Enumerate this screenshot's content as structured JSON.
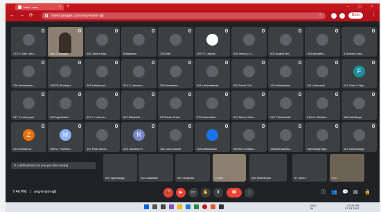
{
  "browser": {
    "tab_title": "Meet - nww",
    "tab_close": "×",
    "new_tab": "+",
    "window_controls": "– ▢ ×",
    "url": "meet.google.com/ovg-fmym-qfj",
    "error_label": "Error",
    "back": "←",
    "forward": "→",
    "reload": "⟳",
    "star": "☆",
    "menu": "⋮"
  },
  "tiles": [
    {
      "name": "273 S Julie Lalru...",
      "avatar": "",
      "color": "#5f6368"
    },
    {
      "name": "Hau Chhangte",
      "avatar": "",
      "color": "#5f6368",
      "video": true
    },
    {
      "name": "081 James Ngu...",
      "avatar": "",
      "color": "#5f6368"
    },
    {
      "name": "Malsawma",
      "avatar": "",
      "color": "#5f6368"
    },
    {
      "name": "103 Mali",
      "avatar": "",
      "color": "#5f6368"
    },
    {
      "name": "326 77.Lalduat...",
      "avatar": "",
      "color": "#ffffff"
    },
    {
      "name": "048 Henry L.H...",
      "avatar": "",
      "color": "#5f6368"
    },
    {
      "name": "002 Angela Bei...",
      "avatar": "",
      "color": "#5f6368"
    },
    {
      "name": "164Lalruatfha...",
      "avatar": "",
      "color": "#5f6368"
    },
    {
      "name": "4.Debory Lalru...",
      "avatar": "",
      "color": "#5f6368"
    },
    {
      "name": "220 Vanlalrinaw...",
      "avatar": "",
      "color": "#5f6368"
    },
    {
      "name": "163 PC Rohtupui",
      "avatar": "",
      "color": "#5f6368"
    },
    {
      "name": "049 Lalfakzuali...",
      "avatar": "",
      "color": "#5f6368"
    },
    {
      "name": "014 C.Lalremru...",
      "avatar": "",
      "color": "#5f6368"
    },
    {
      "name": "295 Vanlalrem...",
      "avatar": "",
      "color": "#5f6368"
    },
    {
      "name": "091 Lalrindmawia",
      "avatar": "",
      "color": "#5f6368"
    },
    {
      "name": "030 David Chh...",
      "avatar": "",
      "color": "#5f6368"
    },
    {
      "name": "12.Lalchhanhimi",
      "avatar": "",
      "color": "#5f6368"
    },
    {
      "name": "114.Lalremeuli",
      "avatar": "",
      "color": "#5f6368"
    },
    {
      "name": "041 Clara F Ngu...",
      "avatar": "F",
      "color": "#1e8e9e"
    },
    {
      "name": "017 C.Lalvenpuii",
      "avatar": "",
      "color": "#5f6368"
    },
    {
      "name": "224 Ngurthanti...",
      "avatar": "",
      "color": "#5f6368"
    },
    {
      "name": "027 C. Lalremr...",
      "avatar": "",
      "color": "#5f6368"
    },
    {
      "name": "047 Elizabeth ...",
      "avatar": "",
      "color": "#5f6368"
    },
    {
      "name": "077Karun Chak...",
      "avatar": "",
      "color": "#5f6368"
    },
    {
      "name": "070 Lalnunthim...",
      "avatar": "",
      "color": "#5f6368"
    },
    {
      "name": "212 Merry Chris...",
      "avatar": "",
      "color": "#5f6368"
    },
    {
      "name": "010 T.Vanlalruati",
      "avatar": "",
      "color": "#5f6368"
    },
    {
      "name": "014.V.L.Rehtha...",
      "avatar": "",
      "color": "#5f6368"
    },
    {
      "name": "118 Lalrotlinga",
      "avatar": "",
      "color": "#5f6368"
    },
    {
      "name": "224 Zothanma...",
      "avatar": "Z",
      "color": "#e8710a"
    },
    {
      "name": "156 M. Thuthlan...",
      "avatar": "M",
      "color": "#8ab4f8"
    },
    {
      "name": "167 Ruthi lalrun...",
      "avatar": "",
      "color": "#5f6368"
    },
    {
      "name": "225 Lalchiani R...",
      "avatar": "R",
      "color": "#7986cb"
    },
    {
      "name": "140 Lalnunmawii",
      "avatar": "",
      "color": "#5f6368"
    },
    {
      "name": "108 Lalbiakzuali",
      "avatar": "",
      "color": "#1a73e8"
    },
    {
      "name": "BIH003 Cordelia...",
      "avatar": "",
      "color": "#5f6368"
    },
    {
      "name": "130Lalhruaichia...",
      "avatar": "",
      "color": "#5f6368"
    },
    {
      "name": "Lalrinsangi Ngh...",
      "avatar": "",
      "color": "#5f6368"
    },
    {
      "name": "107 Lalnunsangi",
      "avatar": "",
      "color": "#5f6368"
    }
  ],
  "bottom_row": [
    {
      "name": "A. Lalchhanhimi"
    },
    {
      "name": "010 Ngursanga..."
    },
    {
      "name": "111 Lalfakawii"
    },
    {
      "name": "012 Hriatpuia"
    },
    {
      "name": "C.Chh..."
    },
    {
      "name": "250 Ramdinpuii"
    },
    {
      "name": "47 others"
    },
    {
      "name": "You"
    }
  ],
  "notice": "R. Lalchhanhimi can now join this meeting",
  "controls": {
    "time": "7:46 PM",
    "separator": "|",
    "meeting_code": "ovg-fmym-qfj",
    "mic": "🎤",
    "cam": "▶",
    "cc": "CC",
    "hand": "✋",
    "present": "⬆",
    "more": "⋮",
    "end": "☎",
    "info": "ⓘ",
    "people": "👥",
    "chat": "💬",
    "activities": "▤",
    "lock": "🔒"
  },
  "taskbar": {
    "lang": "ENG",
    "region": "IN",
    "time": "07:46 PM",
    "date": "07-03-2022"
  }
}
